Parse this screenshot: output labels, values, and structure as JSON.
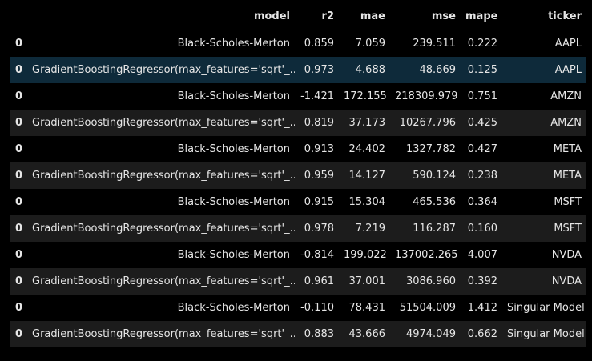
{
  "columns": [
    "",
    "model",
    "r2",
    "mae",
    "mse",
    "mape",
    "ticker"
  ],
  "rows": [
    {
      "index": "0",
      "model": "Black-Scholes-Merton",
      "r2": "0.859",
      "mae": "7.059",
      "mse": "239.511",
      "mape": "0.222",
      "ticker": "AAPL"
    },
    {
      "index": "0",
      "model": "GradientBoostingRegressor(max_features='sqrt'_...",
      "r2": "0.973",
      "mae": "4.688",
      "mse": "48.669",
      "mape": "0.125",
      "ticker": "AAPL"
    },
    {
      "index": "0",
      "model": "Black-Scholes-Merton",
      "r2": "-1.421",
      "mae": "172.155",
      "mse": "218309.979",
      "mape": "0.751",
      "ticker": "AMZN"
    },
    {
      "index": "0",
      "model": "GradientBoostingRegressor(max_features='sqrt'_...",
      "r2": "0.819",
      "mae": "37.173",
      "mse": "10267.796",
      "mape": "0.425",
      "ticker": "AMZN"
    },
    {
      "index": "0",
      "model": "Black-Scholes-Merton",
      "r2": "0.913",
      "mae": "24.402",
      "mse": "1327.782",
      "mape": "0.427",
      "ticker": "META"
    },
    {
      "index": "0",
      "model": "GradientBoostingRegressor(max_features='sqrt'_...",
      "r2": "0.959",
      "mae": "14.127",
      "mse": "590.124",
      "mape": "0.238",
      "ticker": "META"
    },
    {
      "index": "0",
      "model": "Black-Scholes-Merton",
      "r2": "0.915",
      "mae": "15.304",
      "mse": "465.536",
      "mape": "0.364",
      "ticker": "MSFT"
    },
    {
      "index": "0",
      "model": "GradientBoostingRegressor(max_features='sqrt'_...",
      "r2": "0.978",
      "mae": "7.219",
      "mse": "116.287",
      "mape": "0.160",
      "ticker": "MSFT"
    },
    {
      "index": "0",
      "model": "Black-Scholes-Merton",
      "r2": "-0.814",
      "mae": "199.022",
      "mse": "137002.265",
      "mape": "4.007",
      "ticker": "NVDA"
    },
    {
      "index": "0",
      "model": "GradientBoostingRegressor(max_features='sqrt'_...",
      "r2": "0.961",
      "mae": "37.001",
      "mse": "3086.960",
      "mape": "0.392",
      "ticker": "NVDA"
    },
    {
      "index": "0",
      "model": "Black-Scholes-Merton",
      "r2": "-0.110",
      "mae": "78.431",
      "mse": "51504.009",
      "mape": "1.412",
      "ticker": "Singular Model"
    },
    {
      "index": "0",
      "model": "GradientBoostingRegressor(max_features='sqrt'_...",
      "r2": "0.883",
      "mae": "43.666",
      "mse": "4974.049",
      "mape": "0.662",
      "ticker": "Singular Model"
    }
  ],
  "colors": {
    "background": "#000000",
    "row_alt": "#1c1c1c",
    "row_hover": "#0e2a3a",
    "text": "#e6e6e6",
    "header_rule": "#5a5a5a"
  }
}
